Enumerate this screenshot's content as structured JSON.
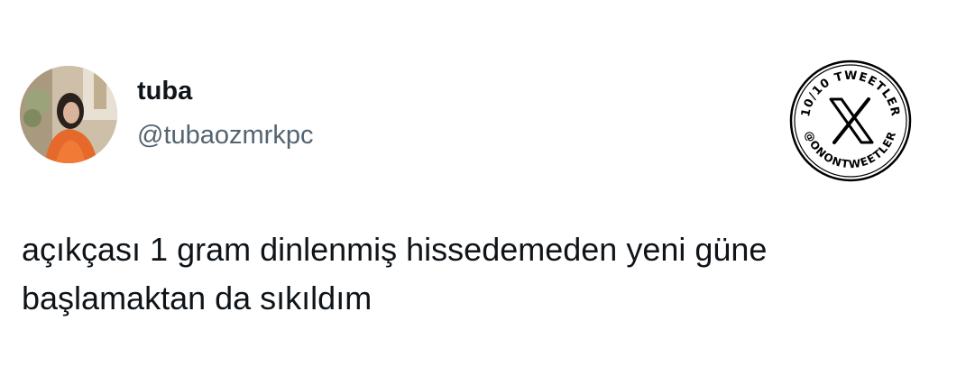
{
  "tweet": {
    "author_name": "tuba",
    "author_handle": "@tubaozmrkpc",
    "text": "açıkçası 1 gram dinlenmiş hissedemeden yeni güne başlamaktan da sıkıldım"
  },
  "badge": {
    "top_text": "10/10 TWEETLER",
    "bottom_text": "@ONONTWEETLER",
    "icon": "x-logo-icon"
  },
  "colors": {
    "text_primary": "#0f1419",
    "text_secondary": "#536471",
    "background": "#ffffff",
    "badge_ink": "#000000"
  }
}
